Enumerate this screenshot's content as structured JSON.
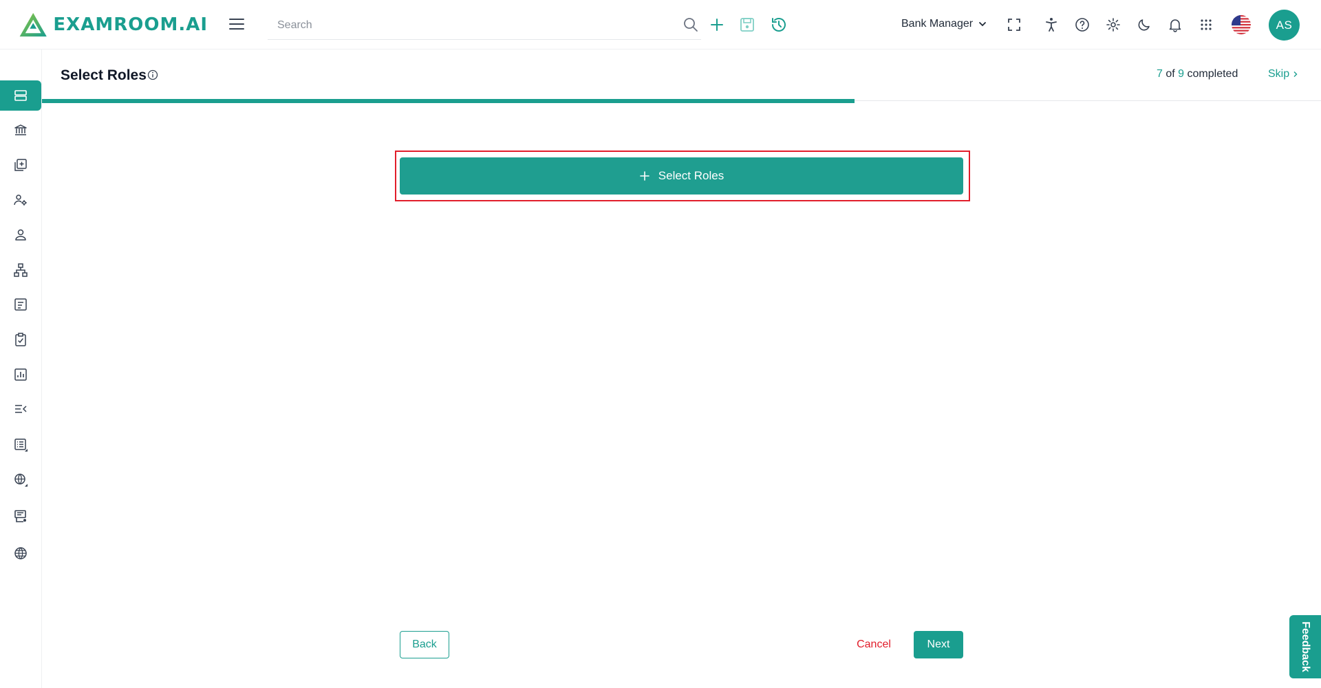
{
  "header": {
    "brand": "EXAMROOM.AI",
    "search_placeholder": "Search",
    "role_label": "Bank Manager",
    "avatar_initials": "AS"
  },
  "page": {
    "title": "Select Roles",
    "progress": {
      "current": "7",
      "of_word": "of",
      "total": "9",
      "suffix": "completed",
      "fraction": 0.778
    },
    "skip_label": "Skip"
  },
  "main": {
    "select_roles_label": "Select Roles",
    "back_label": "Back",
    "cancel_label": "Cancel",
    "next_label": "Next"
  },
  "feedback_label": "Feedback",
  "colors": {
    "accent": "#1a9e8f",
    "danger": "#e11d2a",
    "highlight_border": "#e11d2a"
  },
  "sidebar_icons": [
    "dashboard-icon",
    "bank-icon",
    "add-document-icon",
    "user-settings-icon",
    "user-icon",
    "hierarchy-icon",
    "report-icon",
    "clipboard-check-icon",
    "chart-icon",
    "list-filter-icon",
    "list-icon",
    "globe-settings-icon",
    "printer-icon",
    "globe-icon"
  ]
}
